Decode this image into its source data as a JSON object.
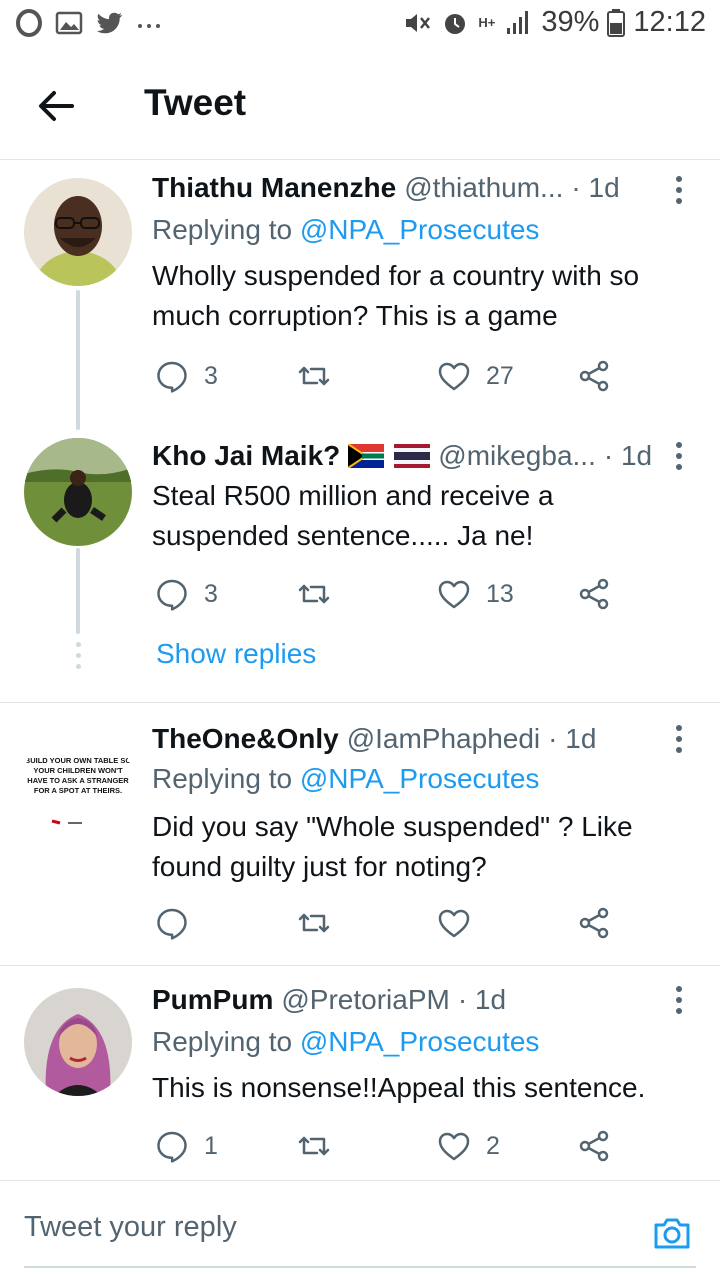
{
  "status_bar": {
    "left_icons": [
      "opera-icon",
      "gallery-icon",
      "twitter-icon",
      "more-dots-icon"
    ],
    "right_icons": [
      "mute-icon",
      "alarm-icon",
      "hplus-icon",
      "signal-icon",
      "battery-icon"
    ],
    "network": "H+",
    "battery": "39%",
    "time": "12:12"
  },
  "header": {
    "title": "Tweet",
    "back_icon": "arrow-left-icon"
  },
  "tweets": [
    {
      "name": "Thiathu Manenzhe",
      "handle": "@thiathum...",
      "time": "· 1d",
      "replying_prefix": "Replying to",
      "replying_to": "@NPA_Prosecutes",
      "text": "Wholly suspended for a country with so much corruption? This is a game",
      "replies": "3",
      "retweets": "",
      "likes": "27"
    },
    {
      "name": "Kho Jai Maik?",
      "flags": [
        "south-africa-flag-icon",
        "thailand-flag-icon"
      ],
      "handle": "@mikegba...",
      "time": "· 1d",
      "text": "Steal R500 million and receive a suspended sentence..... Ja ne!",
      "replies": "3",
      "retweets": "",
      "likes": "13",
      "show_replies": "Show replies"
    },
    {
      "name": "TheOne&Only",
      "handle": "@IamPhaphedi",
      "time": "· 1d",
      "avatar_text": "BUILD YOUR OWN TABLE SO YOUR CHILDREN WON'T HAVE TO ASK A STRANGER FOR A SPOT AT THEIRS.",
      "replying_prefix": "Replying to",
      "replying_to": "@NPA_Prosecutes",
      "text": "Did you say \"Whole suspended\" ? Like found guilty  just for noting?",
      "replies": "",
      "retweets": "",
      "likes": ""
    },
    {
      "name": "PumPum",
      "handle": "@PretoriaPM",
      "time": "· 1d",
      "replying_prefix": "Replying to",
      "replying_to": "@NPA_Prosecutes",
      "text": "This is nonsense!!Appeal this sentence.",
      "replies": "1",
      "retweets": "",
      "likes": "2"
    }
  ],
  "composer": {
    "placeholder": "Tweet your reply",
    "camera_icon": "camera-icon"
  },
  "colors": {
    "accent": "#1d9bf0",
    "secondary_text": "#536471",
    "primary_text": "#0f1419",
    "divider": "#e1e4e8"
  }
}
